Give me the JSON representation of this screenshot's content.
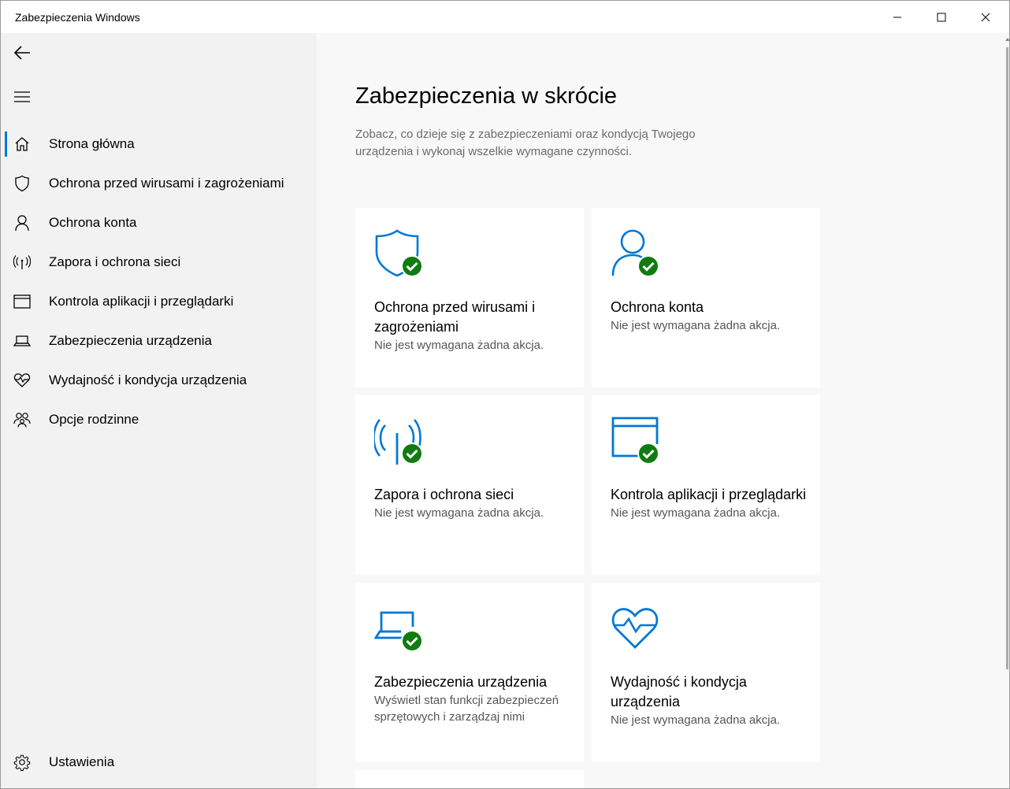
{
  "window": {
    "title": "Zabezpieczenia Windows"
  },
  "colors": {
    "accent": "#0078d7",
    "ok": "#107c10",
    "sidebar_bg": "#f2f2f2"
  },
  "sidebar": {
    "items": [
      {
        "label": "Strona główna",
        "icon": "home-icon"
      },
      {
        "label": "Ochrona przed wirusami i zagrożeniami",
        "icon": "shield-icon"
      },
      {
        "label": "Ochrona konta",
        "icon": "person-icon"
      },
      {
        "label": "Zapora i ochrona sieci",
        "icon": "antenna-icon"
      },
      {
        "label": "Kontrola aplikacji i przeglądarki",
        "icon": "browser-window-icon"
      },
      {
        "label": "Zabezpieczenia urządzenia",
        "icon": "laptop-icon"
      },
      {
        "label": "Wydajność i kondycja urządzenia",
        "icon": "heart-pulse-icon"
      },
      {
        "label": "Opcje rodzinne",
        "icon": "family-icon"
      }
    ],
    "settings_label": "Ustawienia"
  },
  "main": {
    "title": "Zabezpieczenia w skrócie",
    "description": "Zobacz, co dzieje się z zabezpieczeniami oraz kondycją Twojego urządzenia i wykonaj wszelkie wymagane czynności.",
    "cards": [
      {
        "title": "Ochrona przed wirusami i zagrożeniami",
        "status": "Nie jest wymagana żadna akcja.",
        "icon": "shield-icon"
      },
      {
        "title": "Ochrona konta",
        "status": "Nie jest wymagana żadna akcja.",
        "icon": "person-icon"
      },
      {
        "title": "Zapora i ochrona sieci",
        "status": "Nie jest wymagana żadna akcja.",
        "icon": "antenna-icon"
      },
      {
        "title": "Kontrola aplikacji i przeglądarki",
        "status": "Nie jest wymagana żadna akcja.",
        "icon": "browser-window-icon"
      },
      {
        "title": "Zabezpieczenia urządzenia",
        "status": "Wyświetl stan funkcji zabezpieczeń sprzętowych i zarządzaj nimi",
        "icon": "laptop-icon"
      },
      {
        "title": "Wydajność i kondycja urządzenia",
        "status": "Nie jest wymagana żadna akcja.",
        "icon": "heart-pulse-icon"
      }
    ]
  }
}
